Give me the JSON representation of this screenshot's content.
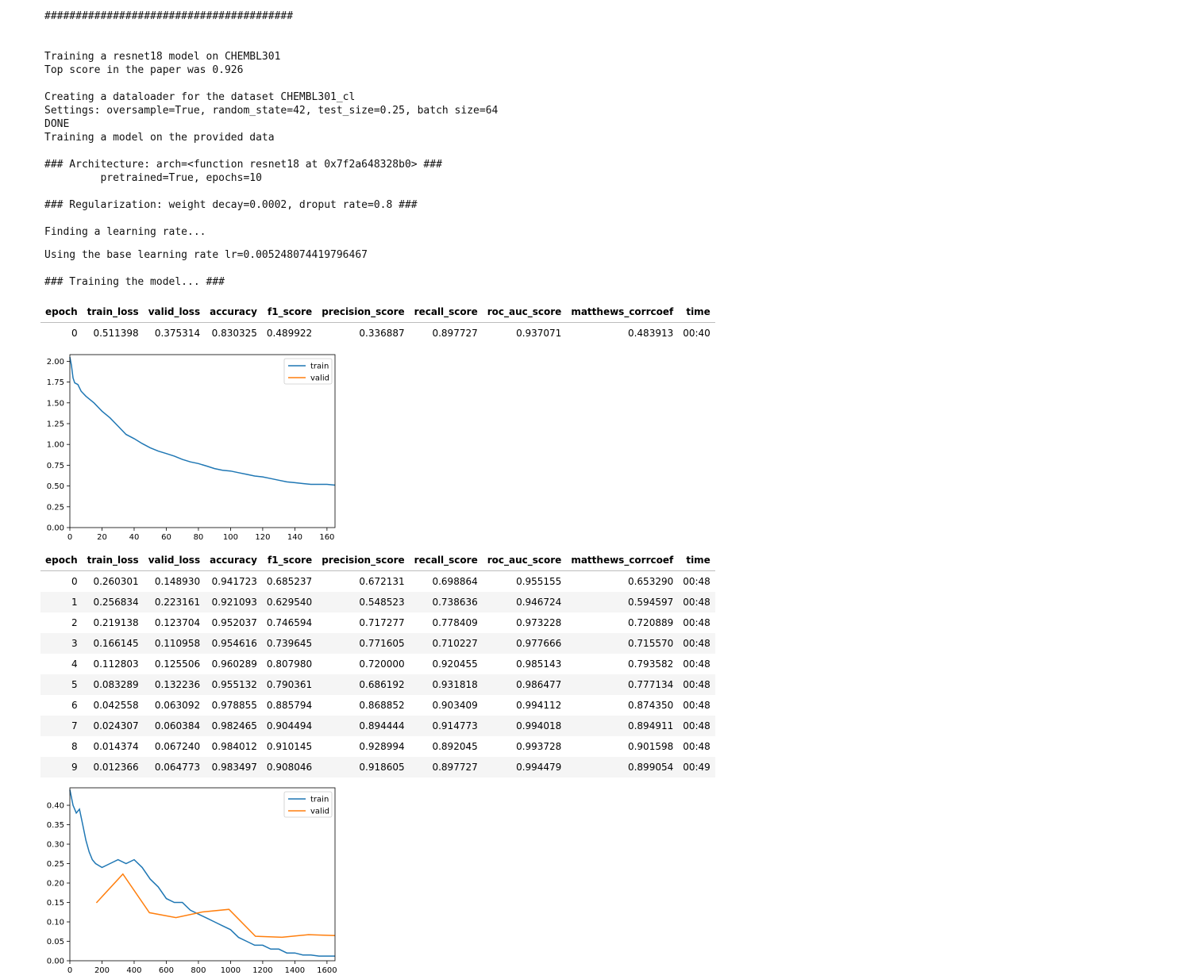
{
  "output": {
    "hash_line": "########################################",
    "intro": [
      "Training a resnet18 model on CHEMBL301",
      "Top score in the paper was 0.926",
      "",
      "Creating a dataloader for the dataset CHEMBL301_cl",
      "Settings: oversample=True, random_state=42, test_size=0.25, batch size=64",
      "DONE",
      "Training a model on the provided data",
      "",
      "### Architecture: arch=<function resnet18 at 0x7f2a648328b0> ###",
      "         pretrained=True, epochs=10",
      "",
      "### Regularization: weight decay=0.0002, droput rate=0.8 ###",
      "",
      "Finding a learning rate..."
    ],
    "lr_line": "Using the base learning rate lr=0.005248074419796467",
    "training_line": "### Training the model... ###"
  },
  "table_headers": [
    "epoch",
    "train_loss",
    "valid_loss",
    "accuracy",
    "f1_score",
    "precision_score",
    "recall_score",
    "roc_auc_score",
    "matthews_corrcoef",
    "time"
  ],
  "table1_rows": [
    [
      "0",
      "0.511398",
      "0.375314",
      "0.830325",
      "0.489922",
      "0.336887",
      "0.897727",
      "0.937071",
      "0.483913",
      "00:40"
    ]
  ],
  "table2_rows": [
    [
      "0",
      "0.260301",
      "0.148930",
      "0.941723",
      "0.685237",
      "0.672131",
      "0.698864",
      "0.955155",
      "0.653290",
      "00:48"
    ],
    [
      "1",
      "0.256834",
      "0.223161",
      "0.921093",
      "0.629540",
      "0.548523",
      "0.738636",
      "0.946724",
      "0.594597",
      "00:48"
    ],
    [
      "2",
      "0.219138",
      "0.123704",
      "0.952037",
      "0.746594",
      "0.717277",
      "0.778409",
      "0.973228",
      "0.720889",
      "00:48"
    ],
    [
      "3",
      "0.166145",
      "0.110958",
      "0.954616",
      "0.739645",
      "0.771605",
      "0.710227",
      "0.977666",
      "0.715570",
      "00:48"
    ],
    [
      "4",
      "0.112803",
      "0.125506",
      "0.960289",
      "0.807980",
      "0.720000",
      "0.920455",
      "0.985143",
      "0.793582",
      "00:48"
    ],
    [
      "5",
      "0.083289",
      "0.132236",
      "0.955132",
      "0.790361",
      "0.686192",
      "0.931818",
      "0.986477",
      "0.777134",
      "00:48"
    ],
    [
      "6",
      "0.042558",
      "0.063092",
      "0.978855",
      "0.885794",
      "0.868852",
      "0.903409",
      "0.994112",
      "0.874350",
      "00:48"
    ],
    [
      "7",
      "0.024307",
      "0.060384",
      "0.982465",
      "0.904494",
      "0.894444",
      "0.914773",
      "0.994018",
      "0.894911",
      "00:48"
    ],
    [
      "8",
      "0.014374",
      "0.067240",
      "0.984012",
      "0.910145",
      "0.928994",
      "0.892045",
      "0.993728",
      "0.901598",
      "00:48"
    ],
    [
      "9",
      "0.012366",
      "0.064773",
      "0.983497",
      "0.908046",
      "0.918605",
      "0.897727",
      "0.994479",
      "0.899054",
      "00:49"
    ]
  ],
  "colors": {
    "train": "#1f77b4",
    "valid": "#ff7f0e"
  },
  "chart_data": [
    {
      "type": "line",
      "legend_position": "top-right",
      "grid": false,
      "xlim": [
        0,
        165
      ],
      "ylim": [
        0,
        2.08
      ],
      "xticks": [
        0,
        20,
        40,
        60,
        80,
        100,
        120,
        140,
        160
      ],
      "yticks": [
        0.0,
        0.25,
        0.5,
        0.75,
        1.0,
        1.25,
        1.5,
        1.75,
        2.0
      ],
      "series": [
        {
          "name": "train",
          "x": [
            0,
            1,
            2,
            3,
            5,
            7,
            10,
            15,
            20,
            25,
            30,
            35,
            40,
            45,
            50,
            55,
            60,
            65,
            70,
            75,
            80,
            85,
            90,
            95,
            100,
            105,
            110,
            115,
            120,
            125,
            130,
            135,
            140,
            145,
            150,
            155,
            160,
            165
          ],
          "y": [
            2.05,
            1.95,
            1.8,
            1.74,
            1.72,
            1.64,
            1.58,
            1.5,
            1.4,
            1.32,
            1.22,
            1.12,
            1.07,
            1.01,
            0.96,
            0.92,
            0.89,
            0.86,
            0.82,
            0.79,
            0.77,
            0.74,
            0.71,
            0.69,
            0.68,
            0.66,
            0.64,
            0.62,
            0.61,
            0.59,
            0.57,
            0.55,
            0.54,
            0.53,
            0.52,
            0.52,
            0.52,
            0.51
          ]
        },
        {
          "name": "valid",
          "x": [],
          "y": []
        }
      ]
    },
    {
      "type": "line",
      "legend_position": "top-right",
      "grid": false,
      "xlim": [
        0,
        1650
      ],
      "ylim": [
        0,
        0.445
      ],
      "xticks": [
        0,
        200,
        400,
        600,
        800,
        1000,
        1200,
        1400,
        1600
      ],
      "yticks": [
        0.0,
        0.05,
        0.1,
        0.15,
        0.2,
        0.25,
        0.3,
        0.35,
        0.4
      ],
      "series": [
        {
          "name": "train",
          "x": [
            0,
            10,
            20,
            40,
            60,
            80,
            100,
            120,
            140,
            160,
            200,
            250,
            300,
            350,
            400,
            450,
            500,
            550,
            600,
            650,
            700,
            750,
            800,
            850,
            900,
            950,
            1000,
            1050,
            1100,
            1150,
            1200,
            1250,
            1300,
            1350,
            1400,
            1450,
            1500,
            1550,
            1600,
            1650
          ],
          "y": [
            0.44,
            0.42,
            0.4,
            0.38,
            0.39,
            0.35,
            0.31,
            0.28,
            0.26,
            0.25,
            0.24,
            0.25,
            0.26,
            0.25,
            0.26,
            0.24,
            0.21,
            0.19,
            0.16,
            0.15,
            0.15,
            0.13,
            0.12,
            0.11,
            0.1,
            0.09,
            0.08,
            0.06,
            0.05,
            0.04,
            0.04,
            0.03,
            0.03,
            0.02,
            0.02,
            0.015,
            0.015,
            0.012,
            0.012,
            0.012
          ]
        },
        {
          "name": "valid",
          "x": [
            165,
            330,
            495,
            660,
            825,
            990,
            1155,
            1320,
            1485,
            1650
          ],
          "y": [
            0.14893,
            0.223161,
            0.123704,
            0.110958,
            0.125506,
            0.132236,
            0.063092,
            0.060384,
            0.06724,
            0.064773
          ]
        }
      ]
    }
  ]
}
